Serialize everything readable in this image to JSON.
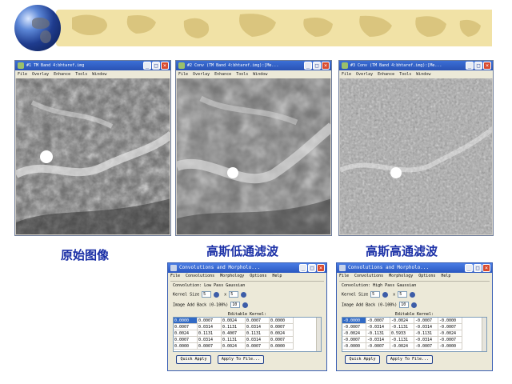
{
  "image_windows": [
    {
      "title": "#1 TM Band 4:bhtaref.img",
      "menu": [
        "File",
        "Overlay",
        "Enhance",
        "Tools",
        "Window"
      ]
    },
    {
      "title": "#2 Conv (TM Band 4:bhtaref.img):[Me...",
      "menu": [
        "File",
        "Overlay",
        "Enhance",
        "Tools",
        "Window"
      ]
    },
    {
      "title": "#3 Conv (TM Band 4:bhtaref.img):[Me...",
      "menu": [
        "File",
        "Overlay",
        "Enhance",
        "Tools",
        "Window"
      ]
    }
  ],
  "captions": {
    "original": "原始图像",
    "lowpass": "高斯低通滤波",
    "highpass": "高斯高通滤波"
  },
  "dialogs": [
    {
      "title": "Convolutions and Morpholo...",
      "menu": [
        "File",
        "Convolutions",
        "Morphology",
        "Options",
        "Help"
      ],
      "convolution": "Convolution: Low Pass Gaussian",
      "kernel_label": "Kernel Size",
      "kernel_a": "5",
      "kernel_x": "x",
      "kernel_b": "5",
      "add_back_label": "Image Add Back (0-100%)",
      "add_back_value": "10",
      "editable_label": "Editable Kernel:",
      "kernel_rows": [
        [
          "0.0000",
          "0.0007",
          "0.0024",
          "0.0007",
          "0.0000"
        ],
        [
          "0.0007",
          "0.0314",
          "0.1131",
          "0.0314",
          "0.0007"
        ],
        [
          "0.0024",
          "0.1131",
          "0.4007",
          "0.1131",
          "0.0024"
        ],
        [
          "0.0007",
          "0.0314",
          "0.1131",
          "0.0314",
          "0.0007"
        ],
        [
          "0.0000",
          "0.0007",
          "0.0024",
          "0.0007",
          "0.0000"
        ]
      ],
      "quick_apply": "Quick Apply",
      "apply_to_file": "Apply To File..."
    },
    {
      "title": "Convolutions and Morpholo...",
      "menu": [
        "File",
        "Convolutions",
        "Morphology",
        "Options",
        "Help"
      ],
      "convolution": "Convolution: High Pass Gaussian",
      "kernel_label": "Kernel Size",
      "kernel_a": "5",
      "kernel_x": "x",
      "kernel_b": "5",
      "add_back_label": "Image Add Back (0-100%)",
      "add_back_value": "10",
      "editable_label": "Editable Kernel:",
      "kernel_rows": [
        [
          "-0.0000",
          "-0.0007",
          "-0.0024",
          "-0.0007",
          "-0.0000"
        ],
        [
          "-0.0007",
          "-0.0314",
          "-0.1131",
          "-0.0314",
          "-0.0007"
        ],
        [
          "-0.0024",
          "-0.1131",
          "0.5933",
          "-0.1131",
          "-0.0024"
        ],
        [
          "-0.0007",
          "-0.0314",
          "-0.1131",
          "-0.0314",
          "-0.0007"
        ],
        [
          "-0.0000",
          "-0.0007",
          "-0.0024",
          "-0.0007",
          "-0.0000"
        ]
      ],
      "quick_apply": "Quick Apply",
      "apply_to_file": "Apply To File..."
    }
  ]
}
